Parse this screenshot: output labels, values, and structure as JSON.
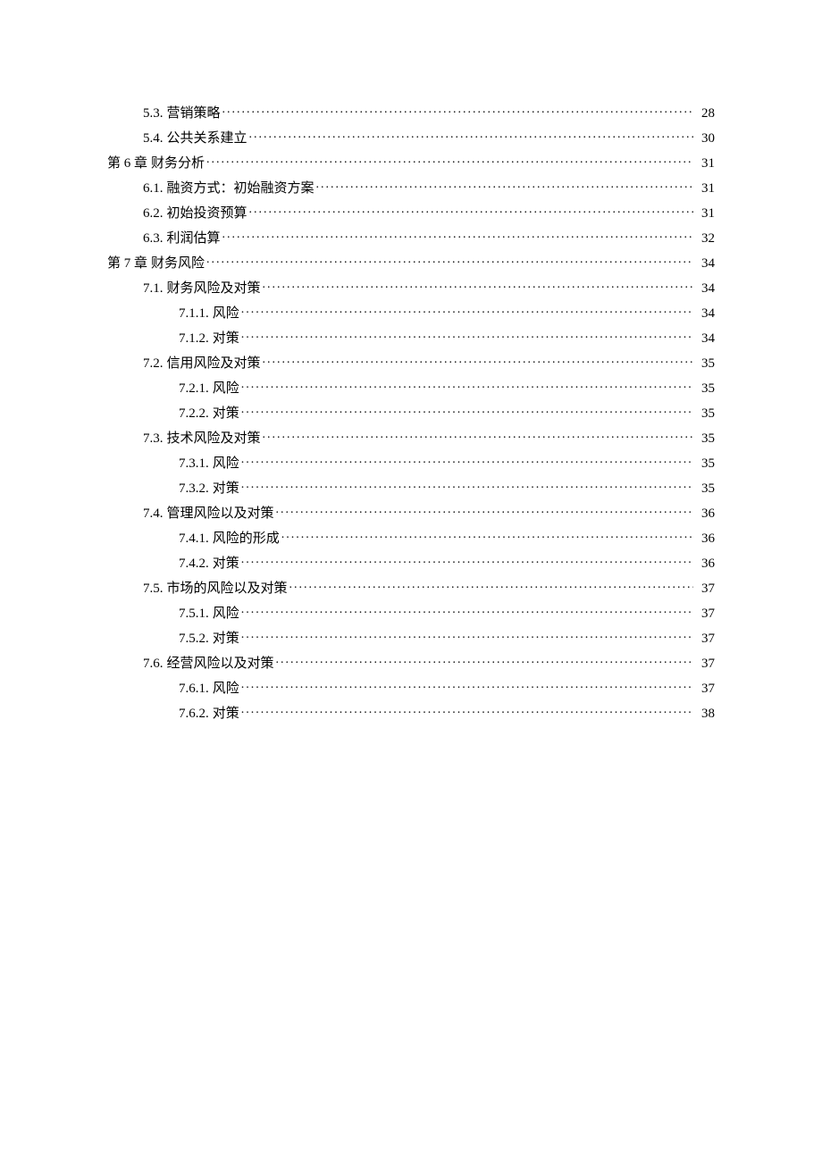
{
  "toc": [
    {
      "level": 2,
      "num": "5.3.",
      "title": "营销策略",
      "page": "28"
    },
    {
      "level": 2,
      "num": "5.4.",
      "title": "公共关系建立",
      "page": "30"
    },
    {
      "level": 1,
      "num": "第 6 章",
      "title": "财务分析",
      "page": "31"
    },
    {
      "level": 2,
      "num": "6.1.",
      "title": "融资方式：初始融资方案",
      "page": "31"
    },
    {
      "level": 2,
      "num": "6.2.",
      "title": "初始投资预算",
      "page": "31"
    },
    {
      "level": 2,
      "num": "6.3.",
      "title": "利润估算",
      "page": "32"
    },
    {
      "level": 1,
      "num": "第 7 章",
      "title": "财务风险",
      "page": "34"
    },
    {
      "level": 2,
      "num": "7.1.",
      "title": "财务风险及对策",
      "page": "34"
    },
    {
      "level": 3,
      "num": "7.1.1.",
      "title": "风险",
      "page": "34"
    },
    {
      "level": 3,
      "num": "7.1.2.",
      "title": "对策",
      "page": "34"
    },
    {
      "level": 2,
      "num": "7.2.",
      "title": "信用风险及对策",
      "page": "35"
    },
    {
      "level": 3,
      "num": "7.2.1.",
      "title": "风险",
      "page": "35"
    },
    {
      "level": 3,
      "num": "7.2.2.",
      "title": "对策",
      "page": "35"
    },
    {
      "level": 2,
      "num": "7.3.",
      "title": "技术风险及对策",
      "page": "35"
    },
    {
      "level": 3,
      "num": "7.3.1.",
      "title": "风险",
      "page": "35"
    },
    {
      "level": 3,
      "num": "7.3.2.",
      "title": "对策",
      "page": "35"
    },
    {
      "level": 2,
      "num": "7.4.",
      "title": "管理风险以及对策",
      "page": "36"
    },
    {
      "level": 3,
      "num": "7.4.1.",
      "title": "风险的形成",
      "page": "36"
    },
    {
      "level": 3,
      "num": "7.4.2.",
      "title": "对策",
      "page": "36"
    },
    {
      "level": 2,
      "num": "7.5.",
      "title": "市场的风险以及对策",
      "page": "37"
    },
    {
      "level": 3,
      "num": "7.5.1.",
      "title": "风险",
      "page": "37"
    },
    {
      "level": 3,
      "num": "7.5.2.",
      "title": "对策",
      "page": "37"
    },
    {
      "level": 2,
      "num": "7.6.",
      "title": "经营风险以及对策",
      "page": "37"
    },
    {
      "level": 3,
      "num": "7.6.1.",
      "title": "风险",
      "page": "37"
    },
    {
      "level": 3,
      "num": "7.6.2.",
      "title": "对策",
      "page": "38"
    }
  ]
}
